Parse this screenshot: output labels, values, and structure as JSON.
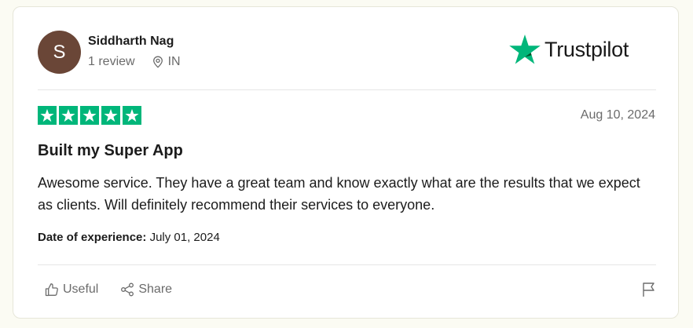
{
  "reviewer": {
    "initial": "S",
    "name": "Siddharth Nag",
    "review_count": "1 review",
    "country": "IN"
  },
  "brand": {
    "name": "Trustpilot",
    "star_color": "#00b67a"
  },
  "review": {
    "rating": 5,
    "max_rating": 5,
    "date": "Aug 10, 2024",
    "title": "Built my Super App",
    "body": "Awesome service. They have a great team and know exactly what are the results that we expect as clients. Will definitely recommend their services to everyone.",
    "experience_label": "Date of experience:",
    "experience_date": "July 01, 2024"
  },
  "actions": {
    "useful_label": "Useful",
    "share_label": "Share",
    "useful_icon": "thumbs-up-icon",
    "share_icon": "share-icon",
    "report_icon": "flag-icon"
  },
  "colors": {
    "avatar_bg": "#6a4637",
    "star_green": "#00b67a",
    "muted_text": "#6b6b6b"
  }
}
